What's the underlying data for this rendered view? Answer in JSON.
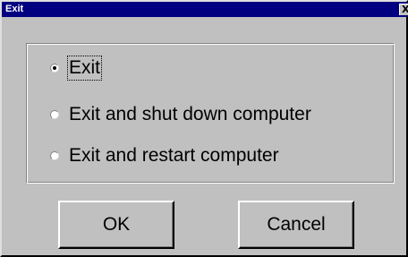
{
  "window": {
    "title": "Exit",
    "close_glyph": "X"
  },
  "options": [
    {
      "label": "Exit",
      "checked": true
    },
    {
      "label": "Exit and shut down computer",
      "checked": false
    },
    {
      "label": "Exit and restart computer",
      "checked": false
    }
  ],
  "buttons": {
    "ok_label": "OK",
    "cancel_label": "Cancel"
  },
  "colors": {
    "titlebar": "#000080",
    "face": "#c0c0c0"
  }
}
